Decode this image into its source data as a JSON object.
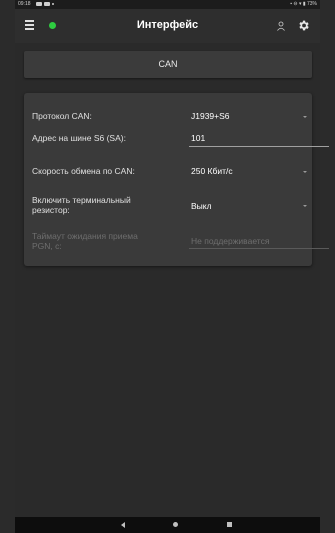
{
  "status_bar": {
    "time": "09:18",
    "right_indicators": "▪ ⊖ ▾ ▮ 73%"
  },
  "app_bar": {
    "title": "Интерфейс",
    "connection_status_color": "#2ecc40",
    "icons": [
      "menu-icon",
      "user-icon",
      "gear-icon"
    ]
  },
  "section_button": {
    "label": "CAN"
  },
  "settings": {
    "protocol": {
      "label": "Протокол CAN:",
      "value": "J1939+S6"
    },
    "bus_address": {
      "label": "Адрес на шине S6 (SA):",
      "value": "101"
    },
    "baud_rate": {
      "label": "Скорость обмена по CAN:",
      "value": "250 Кбит/с"
    },
    "terminal_resistor": {
      "label_line1": "Включить терминальный",
      "label_line2": "резистор:",
      "value": "Выкл"
    },
    "pgn_timeout": {
      "label_line1": "Таймаут ожидания приема",
      "label_line2": "PGN, с:",
      "value": "Не поддерживается"
    }
  },
  "nav_bar": {
    "icons": [
      "back-icon",
      "home-icon",
      "recents-icon"
    ]
  }
}
